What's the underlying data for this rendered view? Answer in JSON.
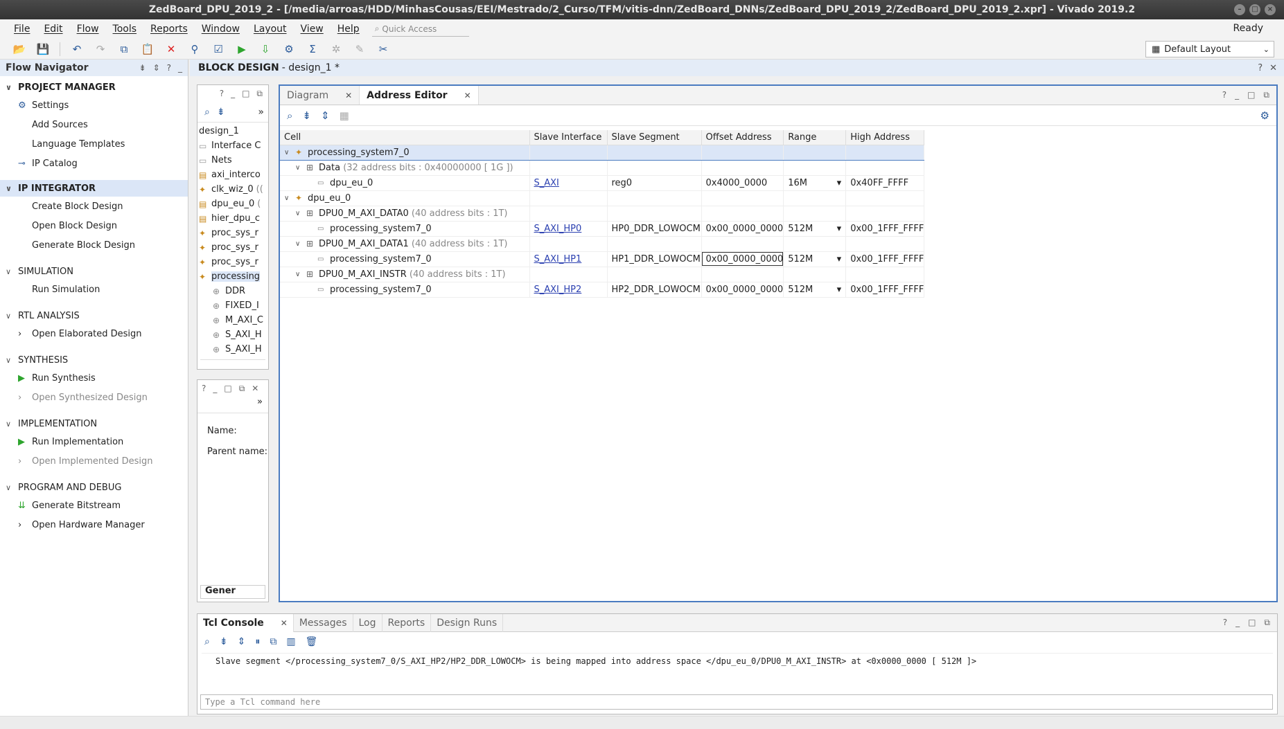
{
  "window": {
    "title": "ZedBoard_DPU_2019_2 - [/media/arroas/HDD/MinhasCousas/EEI/Mestrado/2_Curso/TFM/vitis-dnn/ZedBoard_DNNs/ZedBoard_DPU_2019_2/ZedBoard_DPU_2019_2.xpr] - Vivado 2019.2"
  },
  "menu": [
    "File",
    "Edit",
    "Flow",
    "Tools",
    "Reports",
    "Window",
    "Layout",
    "View",
    "Help"
  ],
  "quick_access": "Quick Access",
  "status": "Ready",
  "layout_select": "Default Layout",
  "flow_navigator": {
    "title": "Flow Navigator",
    "sections": [
      {
        "title": "PROJECT MANAGER",
        "items": [
          "Settings",
          "Add Sources",
          "Language Templates",
          "IP Catalog"
        ]
      },
      {
        "title": "IP INTEGRATOR",
        "items": [
          "Create Block Design",
          "Open Block Design",
          "Generate Block Design"
        ]
      },
      {
        "title": "SIMULATION",
        "items": [
          "Run Simulation"
        ]
      },
      {
        "title": "RTL ANALYSIS",
        "items": [
          "Open Elaborated Design"
        ]
      },
      {
        "title": "SYNTHESIS",
        "items": [
          "Run Synthesis",
          "Open Synthesized Design"
        ]
      },
      {
        "title": "IMPLEMENTATION",
        "items": [
          "Run Implementation",
          "Open Implemented Design"
        ]
      },
      {
        "title": "PROGRAM AND DEBUG",
        "items": [
          "Generate Bitstream",
          "Open Hardware Manager"
        ]
      }
    ]
  },
  "block_design": {
    "label": "BLOCK DESIGN",
    "name": "- design_1 *"
  },
  "sources_tree": {
    "root": "design_1",
    "items": [
      "Interface C",
      "Nets",
      "axi_interco",
      "clk_wiz_0",
      "dpu_eu_0",
      "hier_dpu_c",
      "proc_sys_r",
      "proc_sys_r",
      "proc_sys_r",
      "processing",
      "DDR",
      "FIXED_I",
      "M_AXI_C",
      "S_AXI_H",
      "S_AXI_H"
    ],
    "clk_suffix": "((",
    "dpu_suffix": "("
  },
  "properties": {
    "name_label": "Name:",
    "parent_label": "Parent name:",
    "tab": "Gener"
  },
  "address_editor": {
    "tabs": [
      "Diagram",
      "Address Editor"
    ],
    "columns": [
      "Cell",
      "Slave Interface",
      "Slave Segment",
      "Offset Address",
      "Range",
      "High Address"
    ],
    "rows": [
      {
        "cell": "processing_system7_0",
        "extra": "",
        "level": 0,
        "si": "",
        "seg": "",
        "off": "",
        "range": "",
        "high": ""
      },
      {
        "cell": "Data",
        "extra": "(32 address bits : 0x40000000 [ 1G ])",
        "level": 1,
        "si": "",
        "seg": "",
        "off": "",
        "range": "",
        "high": ""
      },
      {
        "cell": "dpu_eu_0",
        "extra": "",
        "level": 2,
        "si": "S_AXI",
        "seg": "reg0",
        "off": "0x4000_0000",
        "range": "16M",
        "high": "0x40FF_FFFF"
      },
      {
        "cell": "dpu_eu_0",
        "extra": "",
        "level": 0,
        "si": "",
        "seg": "",
        "off": "",
        "range": "",
        "high": ""
      },
      {
        "cell": "DPU0_M_AXI_DATA0",
        "extra": "(40 address bits : 1T)",
        "level": 1,
        "si": "",
        "seg": "",
        "off": "",
        "range": "",
        "high": ""
      },
      {
        "cell": "processing_system7_0",
        "extra": "",
        "level": 2,
        "si": "S_AXI_HP0",
        "seg": "HP0_DDR_LOWOCM",
        "off": "0x00_0000_0000",
        "range": "512M",
        "high": "0x00_1FFF_FFFF"
      },
      {
        "cell": "DPU0_M_AXI_DATA1",
        "extra": "(40 address bits : 1T)",
        "level": 1,
        "si": "",
        "seg": "",
        "off": "",
        "range": "",
        "high": ""
      },
      {
        "cell": "processing_system7_0",
        "extra": "",
        "level": 2,
        "si": "S_AXI_HP1",
        "seg": "HP1_DDR_LOWOCM",
        "off": "0x00_0000_0000",
        "range": "512M",
        "high": "0x00_1FFF_FFFF"
      },
      {
        "cell": "DPU0_M_AXI_INSTR",
        "extra": "(40 address bits : 1T)",
        "level": 1,
        "si": "",
        "seg": "",
        "off": "",
        "range": "",
        "high": ""
      },
      {
        "cell": "processing_system7_0",
        "extra": "",
        "level": 2,
        "si": "S_AXI_HP2",
        "seg": "HP2_DDR_LOWOCM",
        "off": "0x00_0000_0000",
        "range": "512M",
        "high": "0x00_1FFF_FFFF"
      }
    ]
  },
  "tcl": {
    "tabs": [
      "Tcl Console",
      "Messages",
      "Log",
      "Reports",
      "Design Runs"
    ],
    "message": "Slave segment </processing_system7_0/S_AXI_HP2/HP2_DDR_LOWOCM> is being mapped into address space </dpu_eu_0/DPU0_M_AXI_INSTR> at <0x0000_0000 [ 512M ]>",
    "placeholder": "Type a Tcl command here"
  },
  "colors": {
    "accent": "#4a7bc0",
    "selection": "#dbe6f7",
    "run_green": "#2ea52e"
  }
}
